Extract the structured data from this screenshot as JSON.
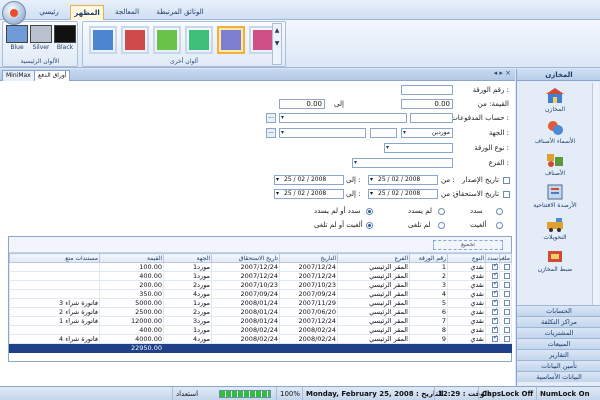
{
  "ribbon": {
    "tabs": [
      {
        "label": "رئيسي",
        "active": false
      },
      {
        "label": "المظهر",
        "active": true
      },
      {
        "label": "المعالجة",
        "active": false
      },
      {
        "label": "الوثائق المرتبطة",
        "active": false
      }
    ],
    "base_colors": {
      "group_label": "الألوان الرئيسية",
      "swatches": [
        {
          "label": "Blue",
          "color": "#6f9bd6"
        },
        {
          "label": "Silver",
          "color": "#b9c2cc"
        },
        {
          "label": "Black",
          "color": "#111111"
        }
      ]
    },
    "other_colors": {
      "group_label": "ألوان أخرى",
      "swatches": [
        {
          "color": "#cf4f86",
          "selected": false
        },
        {
          "color": "#7f7fd0",
          "selected": true
        },
        {
          "color": "#3fc07a",
          "selected": false
        },
        {
          "color": "#6bc24a",
          "selected": false
        },
        {
          "color": "#cf4a4a",
          "selected": false
        },
        {
          "color": "#4d86d0",
          "selected": false
        }
      ],
      "scroll_up": "▲",
      "scroll_down": "▼"
    }
  },
  "doc": {
    "tabs": [
      {
        "label": "MiniMax",
        "active": false
      },
      {
        "label": "أوراق الدفع",
        "active": true
      }
    ],
    "controls": "◂ ▸ ×"
  },
  "form": {
    "doc_number_label": "رقم الورقة :",
    "amount_from_label": "القيمة: من",
    "amount_from": "0.00",
    "to_label": "إلى",
    "amount_to": "0.00",
    "payments_account_label": "حساب المدفوعات :",
    "dots": "...",
    "party_label": "الجهة :",
    "party_value": "موردين",
    "doc_type_label": "نوع الورقة :",
    "branch_label": "الفرع :",
    "issue_date_label": "تاريخ الإصدار",
    "due_date_label": "تاريخ الاستحقاق",
    "from_label": "من :",
    "to2_label": "إلى :",
    "date_from": "25 / 02 / 2008",
    "date_to": "25 / 02 / 2008",
    "radios_row1": {
      "paid": "سدد",
      "unpaid": "لم يسدد",
      "either": "سدد أو لم يسدد"
    },
    "radios_row2": {
      "cancelled": "ألغيت",
      "not_cancelled": "لم تلغى",
      "either": "ألغيت أو لم تلغى"
    }
  },
  "grid": {
    "group_hint": "تجميع",
    "columns": [
      "ملغي",
      "سدد",
      "النوع",
      "رقم الورقة",
      "الفرع",
      "التاريخ",
      "تاريخ الاستحقاق",
      "الجهة",
      "القيمة",
      "مستندات متع"
    ],
    "rows": [
      {
        "type": "نقدي",
        "num": "1",
        "branch": "المقر الرئيسي",
        "date": "2007/12/24",
        "due": "2007/12/24",
        "party": "مورد1",
        "amount": "100.00",
        "docs": ""
      },
      {
        "type": "نقدي",
        "num": "2",
        "branch": "المقر الرئيسي",
        "date": "2007/12/24",
        "due": "2007/12/24",
        "party": "مورد1",
        "amount": "400.00",
        "docs": ""
      },
      {
        "type": "نقدي",
        "num": "3",
        "branch": "المقر الرئيسي",
        "date": "2007/10/23",
        "due": "2007/10/23",
        "party": "مورد2",
        "amount": "200.00",
        "docs": ""
      },
      {
        "type": "نقدي",
        "num": "4",
        "branch": "المقر الرئيسي",
        "date": "2007/09/24",
        "due": "2007/09/24",
        "party": "مورد4",
        "amount": "350.00",
        "docs": ""
      },
      {
        "type": "نقدي",
        "num": "5",
        "branch": "المقر الرئيسي",
        "date": "2007/11/29",
        "due": "2008/01/24",
        "party": "مورد1",
        "amount": "5000.00",
        "docs": "فاتورة شراء 3"
      },
      {
        "type": "نقدي",
        "num": "6",
        "branch": "المقر الرئيسي",
        "date": "2007/06/20",
        "due": "2008/01/24",
        "party": "مورد2",
        "amount": "2500.00",
        "docs": "فاتورة شراء 2"
      },
      {
        "type": "نقدي",
        "num": "7",
        "branch": "المقر الرئيسي",
        "date": "2007/12/24",
        "due": "2008/01/24",
        "party": "مورد3",
        "amount": "12000.00",
        "docs": "فاتورة شراء 1"
      },
      {
        "type": "نقدي",
        "num": "8",
        "branch": "المقر الرئيسي",
        "date": "2008/02/24",
        "due": "2008/02/24",
        "party": "مورد1",
        "amount": "400.00",
        "docs": ""
      },
      {
        "type": "نقدي",
        "num": "9",
        "branch": "المقر الرئيسي",
        "date": "2008/02/24",
        "due": "2008/02/24",
        "party": "مورد4",
        "amount": "4000.00",
        "docs": "فاتورة شراء 4"
      }
    ],
    "total": "22950.00"
  },
  "nav": {
    "header": "المخازن",
    "items": [
      {
        "label": "المخازن",
        "icon": "warehouse-icon"
      },
      {
        "label": "الأسماء الأصناف",
        "icon": "item-names-icon"
      },
      {
        "label": "الأصناف",
        "icon": "items-icon"
      },
      {
        "label": "الأرصدة الافتتاحية",
        "icon": "opening-balances-icon"
      },
      {
        "label": "التحويلات",
        "icon": "transfers-icon"
      },
      {
        "label": "ضبط المخازن",
        "icon": "stock-adjust-icon"
      }
    ],
    "sections": [
      "الحسابات",
      "مراكز التكلفة",
      "المشتريات",
      "المبيعات",
      "التقارير",
      "تأمين البيانات",
      "البيانات الأساسية"
    ]
  },
  "status": {
    "numlock": "NumLock On",
    "capslock": "CapsLock Off",
    "time": "12:29 : الوقت",
    "date": "Monday, February 25, 2008 : التاريخ",
    "zoom": "100%",
    "progress": 100,
    "ready": "استعداد"
  }
}
